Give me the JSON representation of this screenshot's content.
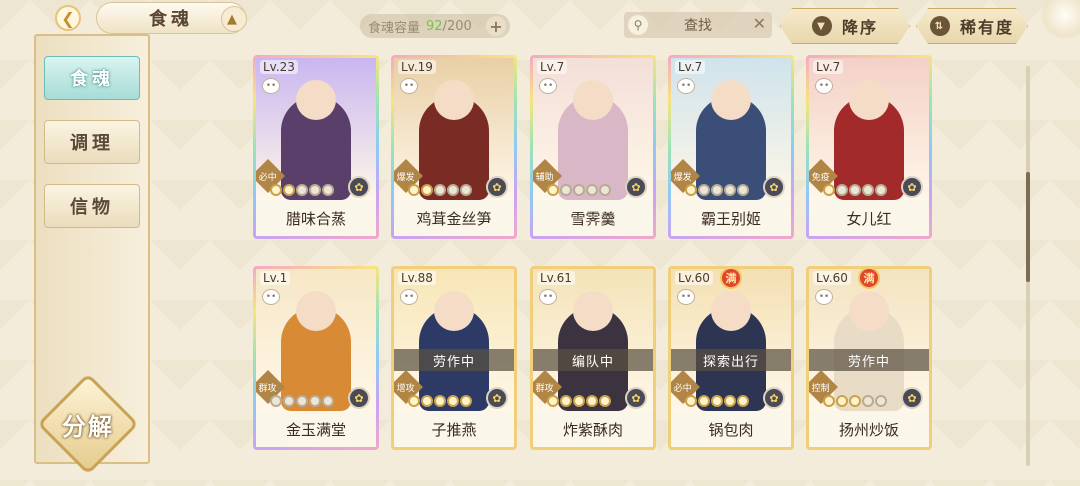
{
  "header": {
    "title": "食魂",
    "capacity_label": "食魂容量",
    "capacity_current": "92",
    "capacity_max": "/200",
    "search_label": "查找",
    "sort_label": "降序",
    "rarity_label": "稀有度"
  },
  "sidebar": {
    "items": [
      {
        "label": "食魂"
      },
      {
        "label": "调理"
      },
      {
        "label": "信物"
      }
    ],
    "decompose_label": "分解"
  },
  "cards": [
    {
      "level": "Lv.23",
      "name": "腊味合蒸",
      "role": "必中",
      "stars": 2,
      "status": "",
      "full": false,
      "rainbow": true,
      "bg": "#c9b6f0",
      "fig": "#5b3f6b"
    },
    {
      "level": "Lv.19",
      "name": "鸡茸金丝笋",
      "role": "爆发",
      "stars": 2,
      "status": "",
      "full": false,
      "rainbow": true,
      "bg": "#e9cfa6",
      "fig": "#7a2c24"
    },
    {
      "level": "Lv.7",
      "name": "雪霁羹",
      "role": "辅助",
      "stars": 1,
      "status": "",
      "full": false,
      "rainbow": true,
      "bg": "#f3dfd8",
      "fig": "#d9b7c6"
    },
    {
      "level": "Lv.7",
      "name": "霸王别姬",
      "role": "爆发",
      "stars": 1,
      "status": "",
      "full": false,
      "rainbow": true,
      "bg": "#cfe3ec",
      "fig": "#3a4e78"
    },
    {
      "level": "Lv.7",
      "name": "女儿红",
      "role": "免疫",
      "stars": 1,
      "status": "",
      "full": false,
      "rainbow": true,
      "bg": "#f3d0c8",
      "fig": "#a22a2a"
    },
    {
      "level": "Lv.1",
      "name": "金玉满堂",
      "role": "群攻",
      "stars": 0,
      "status": "",
      "full": false,
      "rainbow": true,
      "bg": "#f6e7c6",
      "fig": "#d88a35"
    },
    {
      "level": "Lv.88",
      "name": "子推燕",
      "role": "增攻",
      "stars": 5,
      "status": "劳作中",
      "full": false,
      "rainbow": false,
      "bg": "#f7e6b6",
      "fig": "#2d3a66"
    },
    {
      "level": "Lv.61",
      "name": "炸紫酥肉",
      "role": "群攻",
      "stars": 5,
      "status": "编队中",
      "full": false,
      "rainbow": false,
      "bg": "#f4e3b8",
      "fig": "#3b3340"
    },
    {
      "level": "Lv.60",
      "name": "锅包肉",
      "role": "必中",
      "stars": 5,
      "status": "探索出行",
      "full": true,
      "rainbow": false,
      "bg": "#f3e0b2",
      "fig": "#2e3552"
    },
    {
      "level": "Lv.60",
      "name": "扬州炒饭",
      "role": "控制",
      "stars": 3,
      "status": "劳作中",
      "full": true,
      "rainbow": false,
      "bg": "#f3e3c0",
      "fig": "#e8dcc6"
    }
  ],
  "badges": {
    "full": "满"
  },
  "icons": {
    "back": "back-arrow-icon",
    "plus": "plus-icon",
    "search": "magnifier-icon",
    "clear": "close-icon",
    "element": "element-orb-icon"
  },
  "colors": {
    "capacity_current": "#7fbf4a",
    "active_tab": "#a7dcd7",
    "card_gold": "#f1cf7a"
  }
}
